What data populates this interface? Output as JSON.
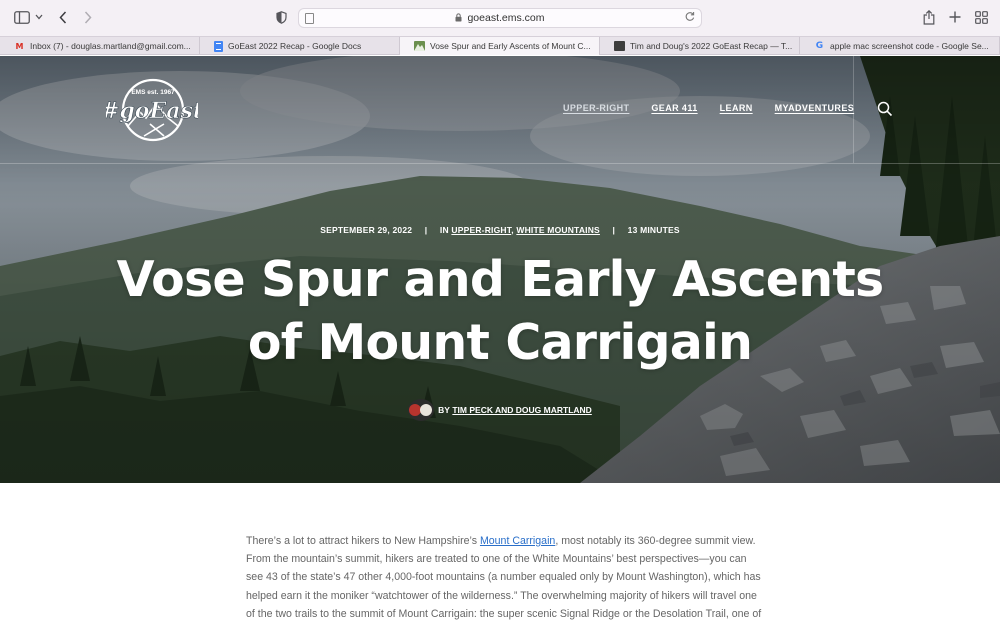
{
  "browser": {
    "url": "goeast.ems.com",
    "tabs": [
      {
        "label": "Inbox (7) - douglas.martland@gmail.com...",
        "favicon": "gmail-icon",
        "active": false
      },
      {
        "label": "GoEast 2022 Recap - Google Docs",
        "favicon": "google-docs-icon",
        "active": false
      },
      {
        "label": "Vose Spur and Early Ascents of Mount C...",
        "favicon": "mountain-icon",
        "active": true
      },
      {
        "label": "Tim and Doug's 2022 GoEast Recap — T...",
        "favicon": "cube-icon",
        "active": false
      },
      {
        "label": "apple mac screenshot code - Google Se...",
        "favicon": "google-icon",
        "active": false
      }
    ]
  },
  "site": {
    "logo": {
      "top_text": "EMS est. 1967",
      "wordmark": "#goEast"
    },
    "nav": [
      {
        "label": "UPPER-RIGHT",
        "current": true
      },
      {
        "label": "GEAR 411",
        "current": false
      },
      {
        "label": "LEARN",
        "current": false
      },
      {
        "label": "MYADVENTURES",
        "current": false
      }
    ]
  },
  "post": {
    "date": "SEPTEMBER 29, 2022",
    "in_prefix": "IN",
    "categories": [
      "UPPER-RIGHT",
      "WHITE MOUNTAINS"
    ],
    "category_separator": ",",
    "read_time": "13 MINUTES",
    "separator": "|",
    "title_line1": "Vose Spur and Early Ascents",
    "title_line2": "of Mount Carrigain",
    "by_prefix": "BY",
    "author": "TIM PECK AND DOUG MARTLAND",
    "body": {
      "line1_before": "There’s a lot to attract hikers to New Hampshire’s ",
      "line1_link": "Mount Carrigain",
      "line1_after": ", most notably its 360-degree summit view.",
      "line2": "From the mountain’s summit, hikers are treated to one of the White Mountains’ best perspectives—you can",
      "line3": "see 43 of the state’s 47 other 4,000-foot mountains (a number equaled only by Mount Washington), which has",
      "line4": "helped earn it the moniker “watchtower of the wilderness.” The overwhelming majority of hikers will travel one",
      "line5": "of the two trails to the summit of Mount Carrigain: the super scenic Signal Ridge or the Desolation Trail, one of"
    }
  },
  "colors": {
    "link": "#2a6fc9",
    "body_text": "#666666",
    "hero_text": "#ffffff"
  }
}
